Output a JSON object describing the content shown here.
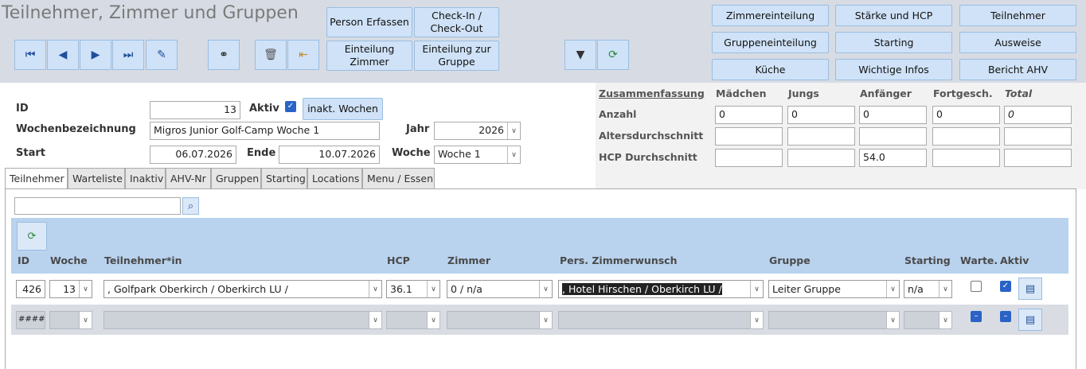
{
  "title": "Teilnehmer, Zimmer und Gruppen",
  "toolbar": {
    "person_erfassen": "Person Erfassen",
    "check_in_out": "Check-In / Check-Out",
    "einteilung_zimmer": "Einteilung Zimmer",
    "einteilung_gruppe": "Einteilung zur Gruppe",
    "zimmereinteilung": "Zimmereinteilung",
    "staerke_hcp": "Stärke und HCP",
    "teilnehmer": "Teilnehmer",
    "gruppeneinteilung": "Gruppeneinteilung",
    "starting": "Starting",
    "ausweise": "Ausweise",
    "kueche": "Küche",
    "wichtige_infos": "Wichtige Infos",
    "bericht_ahv": "Bericht  AHV"
  },
  "form": {
    "id_label": "ID",
    "id_value": "13",
    "aktiv_label": "Aktiv",
    "inakt_button": "inakt. Wochen",
    "wochenbez_label": "Wochenbezeichnung",
    "wochenbez_value": "Migros Junior Golf-Camp Woche 1",
    "jahr_label": "Jahr",
    "jahr_value": "2026",
    "start_label": "Start",
    "start_value": "06.07.2026",
    "ende_label": "Ende",
    "ende_value": "10.07.2026",
    "woche_label": "Woche",
    "woche_value": "Woche 1"
  },
  "summary": {
    "title": "Zusammenfassung",
    "columns": [
      "Mädchen",
      "Jungs",
      "Anfänger",
      "Fortgesch.",
      "Total"
    ],
    "rows": {
      "anzahl_label": "Anzahl",
      "anzahl": [
        "0",
        "0",
        "0",
        "0",
        "0"
      ],
      "alter_label": "Altersdurchschnitt",
      "alter": [
        "",
        "",
        "",
        "",
        ""
      ],
      "hcp_label": "HCP Durchschnitt",
      "hcp": [
        "",
        "",
        "54.0",
        "",
        ""
      ]
    }
  },
  "tabs": [
    "Teilnehmer",
    "Warteliste",
    "Inaktiv",
    "AHV-Nr",
    "Gruppen",
    "Starting",
    "Locations",
    "Menu / Essen"
  ],
  "grid": {
    "headers": [
      "ID",
      "Woche",
      "Teilnehmer*in",
      "HCP",
      "Zimmer",
      "Pers. Zimmerwunsch",
      "Gruppe",
      "Starting",
      "Warte.",
      "Aktiv"
    ],
    "row1": {
      "id": "426",
      "woche": "13",
      "teilnehmer": ", Golfpark Oberkirch / Oberkirch LU /",
      "hcp": "36.1",
      "zimmer": "0 / n/a",
      "wunsch": ", Hotel Hirschen / Oberkirch LU /",
      "gruppe": "Leiter Gruppe",
      "starting": "n/a"
    },
    "row2": {
      "id": "#####"
    }
  }
}
